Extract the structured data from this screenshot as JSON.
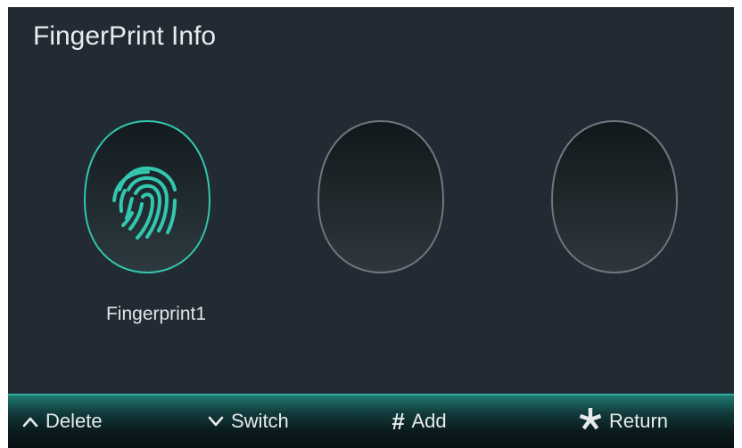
{
  "screen": {
    "title": "FingerPrint Info"
  },
  "fingerprints": {
    "slots": [
      {
        "label": "Fingerprint1",
        "enrolled": true,
        "icon": "fingerprint-icon"
      },
      {
        "label": "",
        "enrolled": false
      },
      {
        "label": "",
        "enrolled": false
      }
    ]
  },
  "footer": {
    "delete": {
      "label": "Delete",
      "icon": "chevron-up-icon"
    },
    "switch": {
      "label": "Switch",
      "icon": "chevron-down-icon"
    },
    "add": {
      "label": "Add",
      "icon": "hash-icon",
      "glyph": "#"
    },
    "return": {
      "label": "Return",
      "icon": "asterisk-icon"
    }
  },
  "colors": {
    "background": "#222b33",
    "accent": "#33c7b0",
    "empty_outline": "#6f787e",
    "text": "#e8ecef",
    "footer_top": "#1f7f74"
  }
}
